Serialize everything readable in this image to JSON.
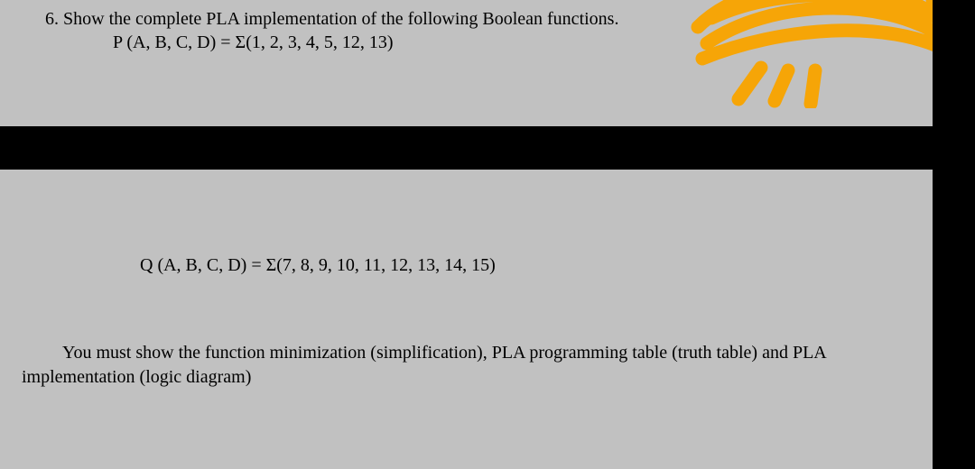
{
  "question": {
    "number_label": "6. ",
    "prompt": "Show the complete PLA implementation of the following Boolean functions.",
    "func_p": "P (A, B, C, D)  =  Σ(1, 2, 3, 4, 5, 12, 13)",
    "func_q": "Q (A, B, C, D)  =  Σ(7, 8, 9, 10, 11, 12, 13, 14, 15)",
    "instructions": "You must show the function minimization (simplification), PLA programming table (truth table) and PLA implementation (logic diagram)"
  }
}
